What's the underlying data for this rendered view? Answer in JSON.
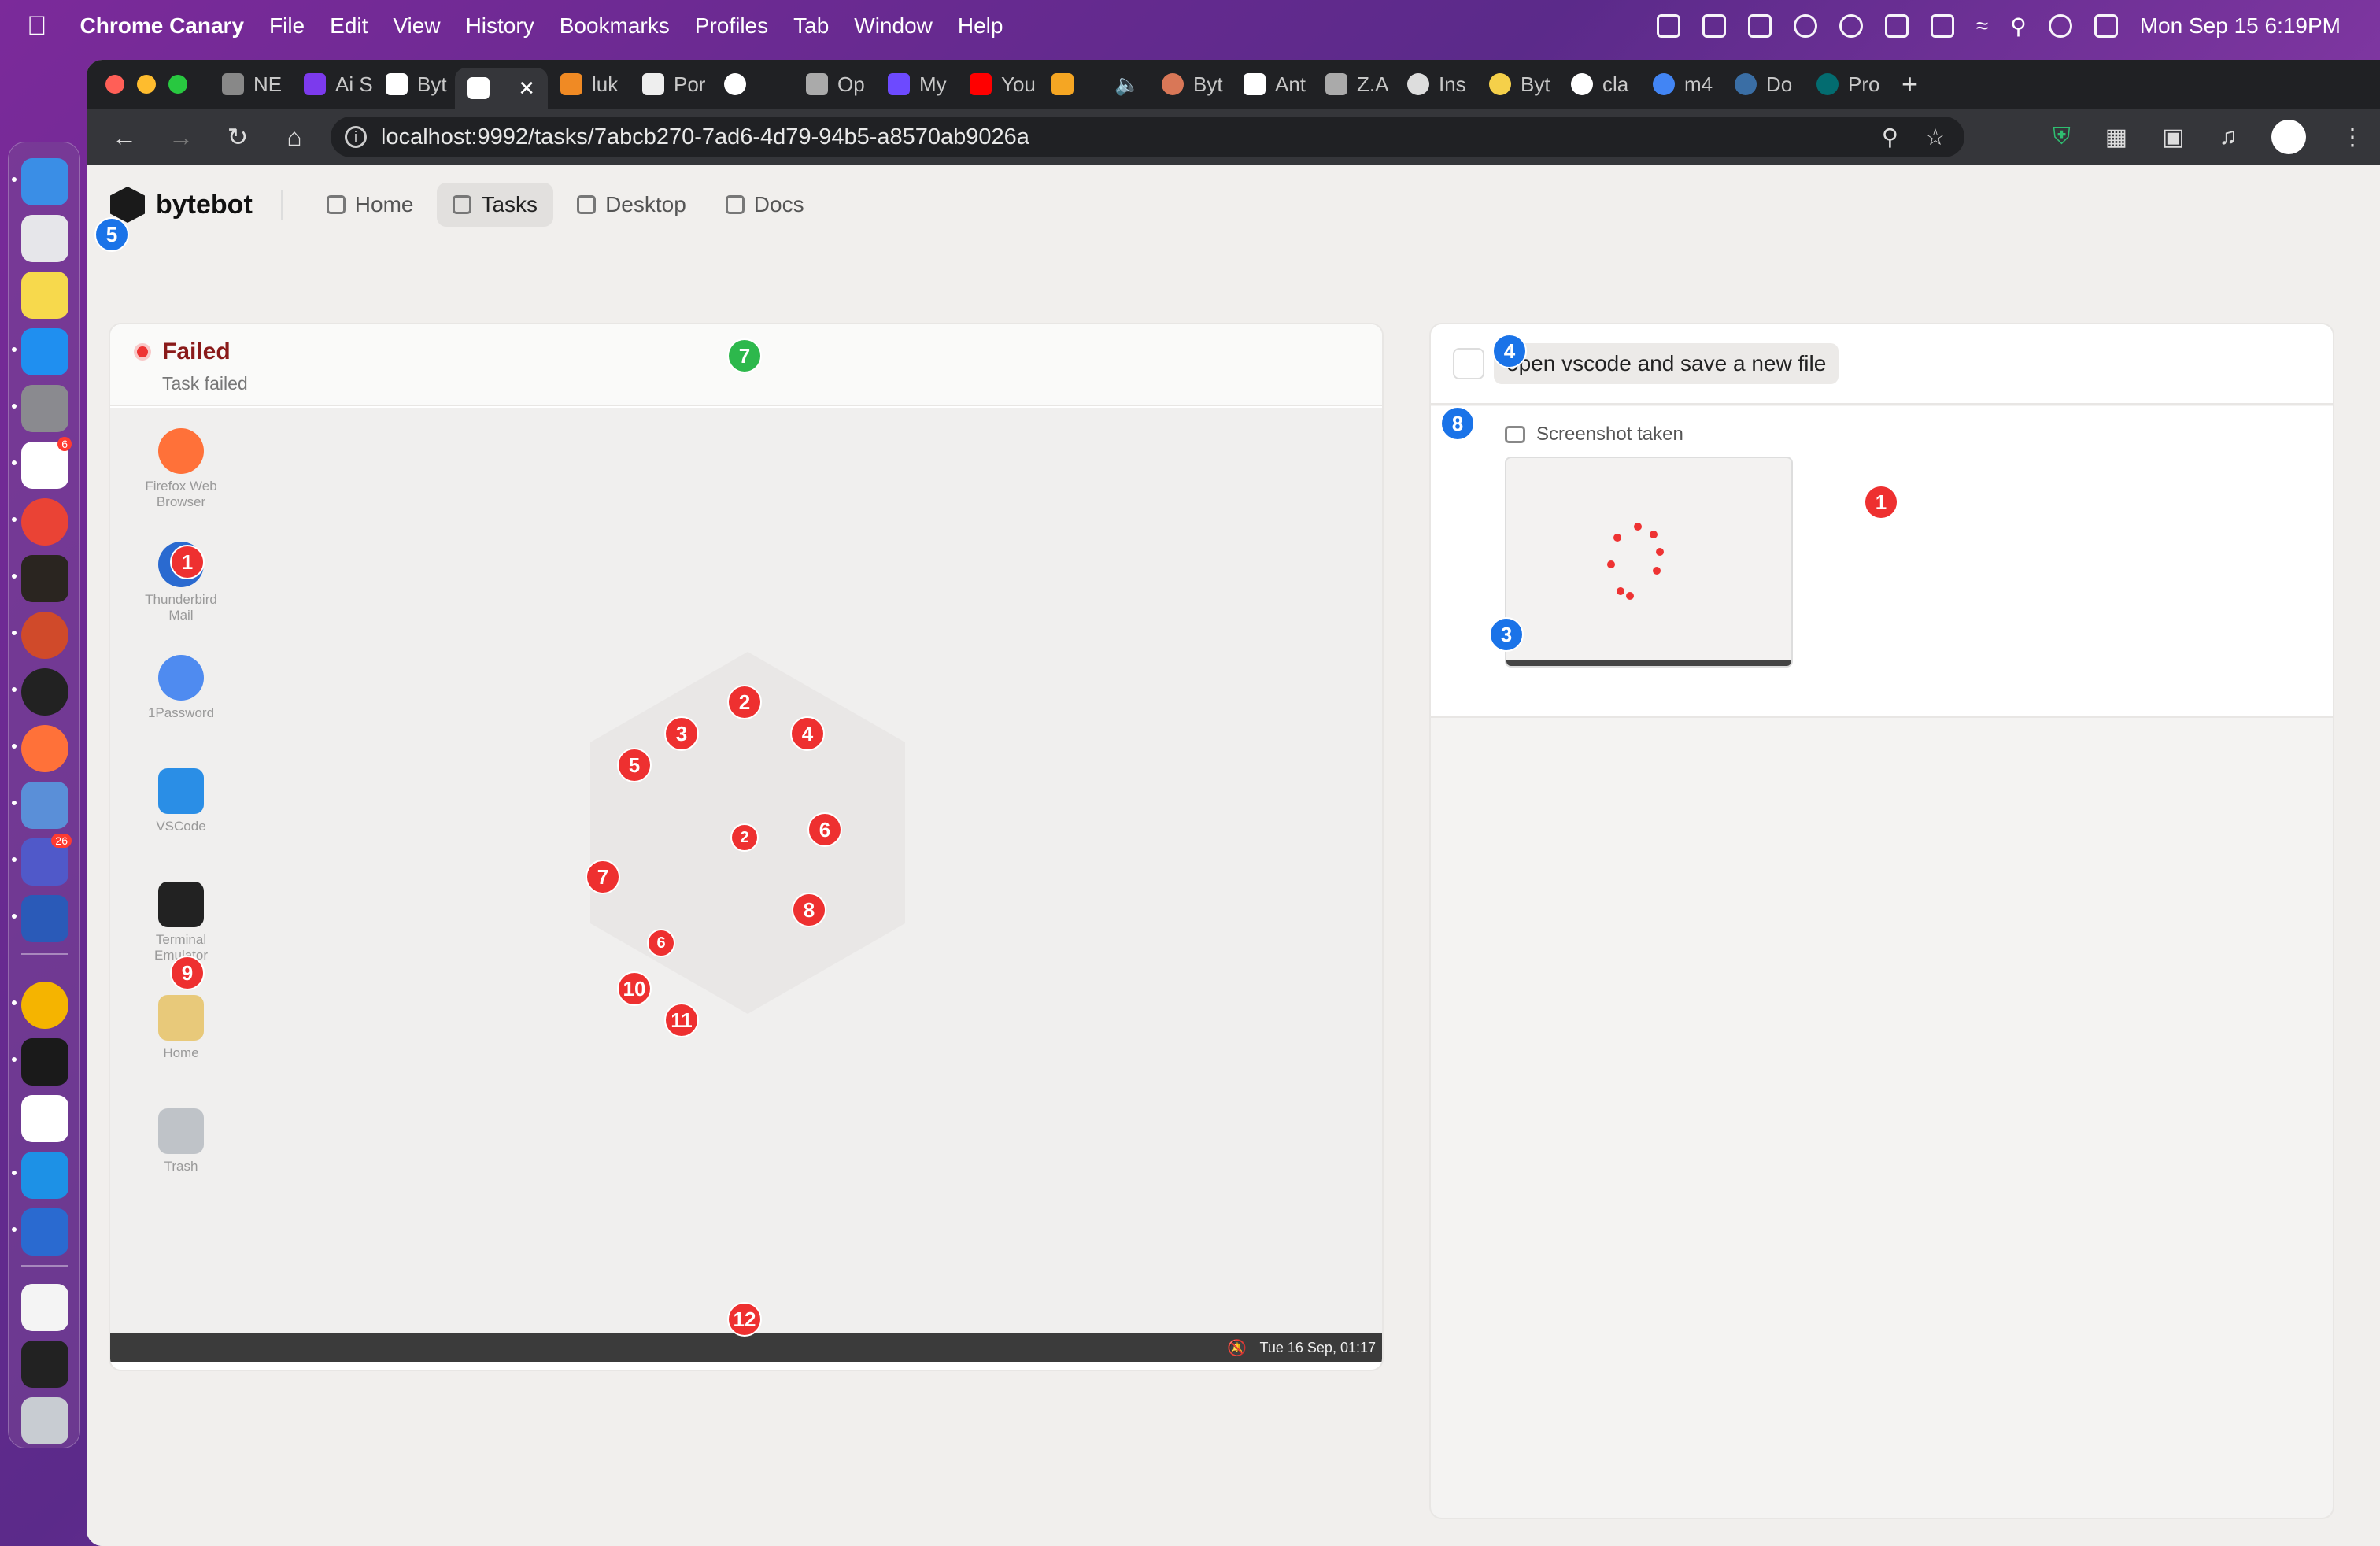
{
  "menubar": {
    "app": "Chrome Canary",
    "items": [
      "File",
      "Edit",
      "View",
      "History",
      "Bookmarks",
      "Profiles",
      "Tab",
      "Window",
      "Help"
    ],
    "datetime": "Mon Sep 15  6:19PM"
  },
  "browser": {
    "tabs": [
      "NE",
      "Ai S",
      "Byt",
      "",
      "luk",
      "Por",
      "",
      "Op",
      "My",
      "You",
      "",
      "",
      "Byt",
      "Ant",
      "Z.A",
      "Ins",
      "Byt",
      "cla",
      "m4",
      "Do",
      "Pro"
    ],
    "new_tab": "+",
    "url": "localhost:9992/tasks/7abcb270-7ad6-4d79-94b5-a8570ab9026a"
  },
  "app": {
    "brand": "bytebot",
    "nav": [
      "Home",
      "Tasks",
      "Desktop",
      "Docs"
    ],
    "active_nav": "Tasks"
  },
  "task": {
    "status": "Failed",
    "substatus": "Task failed",
    "message": "open vscode and save a new file",
    "screenshot_label": "Screenshot taken"
  },
  "desktop": {
    "icons": [
      "Firefox Web Browser",
      "Thunderbird Mail",
      "1Password",
      "VSCode",
      "Terminal Emulator",
      "Home",
      "Trash"
    ],
    "clock": "Tue 16 Sep, 01:17"
  },
  "markers": {
    "m1": "1",
    "m2": "2",
    "m3": "3",
    "m4": "4",
    "m5": "5",
    "m6": "6",
    "m7": "7",
    "m8": "8",
    "m9": "9",
    "m10": "10",
    "m11": "11",
    "m12": "12",
    "s2": "2",
    "s6": "6",
    "b3": "3",
    "b4": "4",
    "b5": "5",
    "b8": "8",
    "g7": "7",
    "r1": "1"
  },
  "colors": {
    "failed": "#8a1a1a",
    "marker_red": "#ee3030",
    "marker_blue": "#1a73e8",
    "marker_green": "#2db84c"
  }
}
